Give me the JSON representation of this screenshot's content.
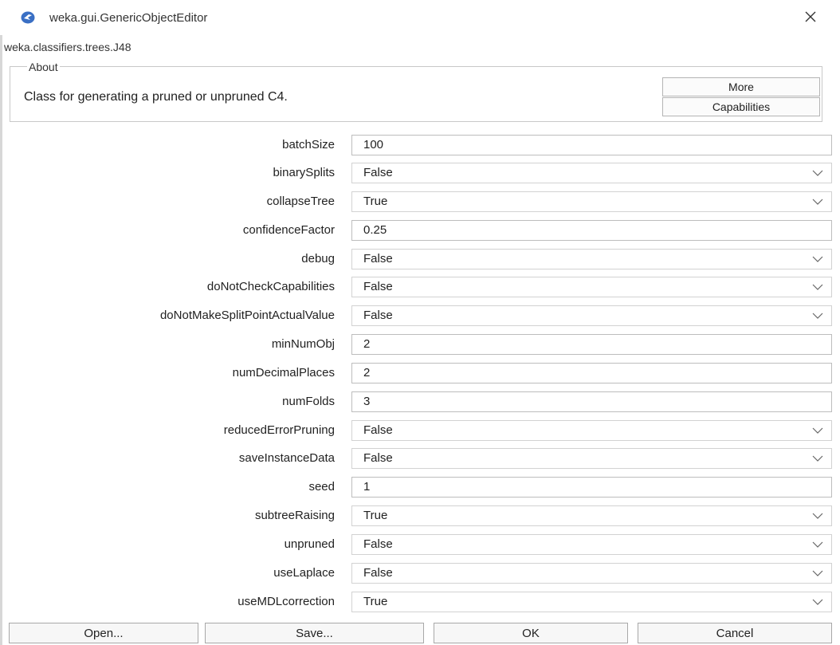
{
  "window": {
    "title": "weka.gui.GenericObjectEditor",
    "close_glyph": "✕"
  },
  "class_name": "weka.classifiers.trees.J48",
  "about": {
    "legend": "About",
    "description": "Class for generating a pruned or unpruned C4.",
    "more_label": "More",
    "capabilities_label": "Capabilities"
  },
  "properties": [
    {
      "label": "batchSize",
      "value": "100",
      "kind": "text"
    },
    {
      "label": "binarySplits",
      "value": "False",
      "kind": "select"
    },
    {
      "label": "collapseTree",
      "value": "True",
      "kind": "select"
    },
    {
      "label": "confidenceFactor",
      "value": "0.25",
      "kind": "text"
    },
    {
      "label": "debug",
      "value": "False",
      "kind": "select"
    },
    {
      "label": "doNotCheckCapabilities",
      "value": "False",
      "kind": "select"
    },
    {
      "label": "doNotMakeSplitPointActualValue",
      "value": "False",
      "kind": "select"
    },
    {
      "label": "minNumObj",
      "value": "2",
      "kind": "text"
    },
    {
      "label": "numDecimalPlaces",
      "value": "2",
      "kind": "text"
    },
    {
      "label": "numFolds",
      "value": "3",
      "kind": "text"
    },
    {
      "label": "reducedErrorPruning",
      "value": "False",
      "kind": "select"
    },
    {
      "label": "saveInstanceData",
      "value": "False",
      "kind": "select"
    },
    {
      "label": "seed",
      "value": "1",
      "kind": "text"
    },
    {
      "label": "subtreeRaising",
      "value": "True",
      "kind": "select"
    },
    {
      "label": "unpruned",
      "value": "False",
      "kind": "select"
    },
    {
      "label": "useLaplace",
      "value": "False",
      "kind": "select"
    },
    {
      "label": "useMDLcorrection",
      "value": "True",
      "kind": "select"
    }
  ],
  "buttons": {
    "open": "Open...",
    "save": "Save...",
    "ok": "OK",
    "cancel": "Cancel"
  },
  "colors": {
    "app_icon": "#3a6fc4",
    "border": "#bdbdbd"
  }
}
